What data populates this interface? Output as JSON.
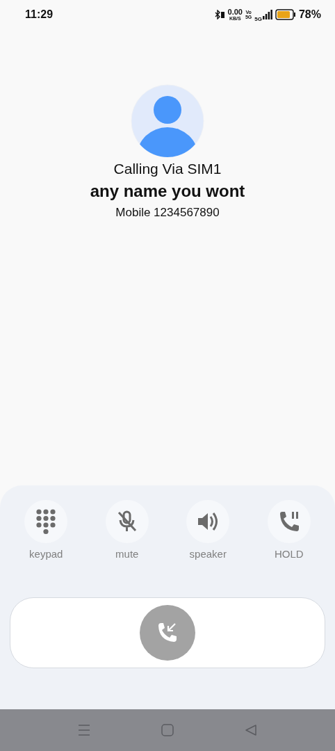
{
  "status_bar": {
    "time": "11:29",
    "speed": "0.00",
    "speed_unit": "KB/S",
    "volte_top": "Vo",
    "volte_bottom": "5G",
    "network": "5G",
    "battery": "78%"
  },
  "call": {
    "via": "Calling Via SIM1",
    "name": "any name you wont",
    "number": "Mobile 1234567890"
  },
  "controls": [
    {
      "kind": "keypad",
      "label": "keypad"
    },
    {
      "kind": "mute",
      "label": "mute"
    },
    {
      "kind": "speaker",
      "label": "speaker"
    },
    {
      "kind": "hold",
      "label": "HOLD"
    }
  ]
}
